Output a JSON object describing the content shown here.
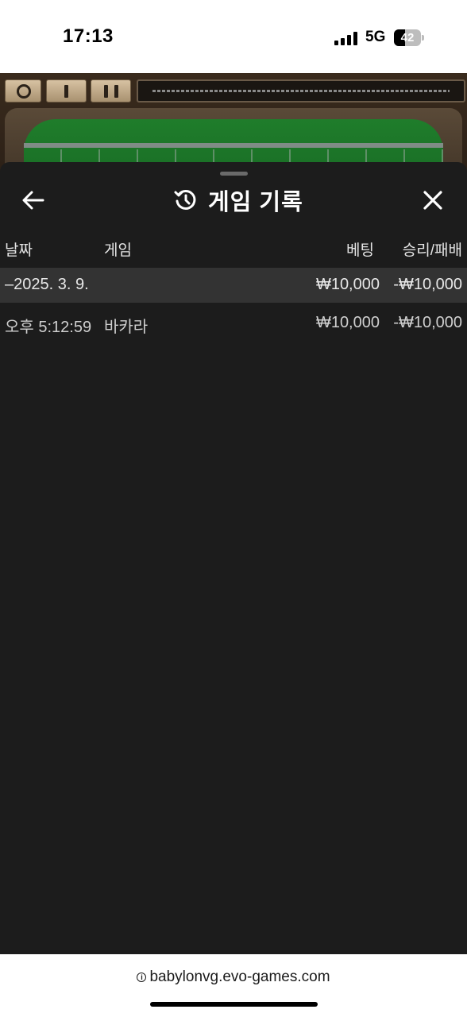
{
  "status": {
    "time": "17:13",
    "network": "5G",
    "battery_level": "42",
    "battery_fraction": 0.42
  },
  "sheet": {
    "title": "게임 기록",
    "icons": {
      "back": "arrow-left-icon",
      "history": "history-icon",
      "close": "close-icon"
    }
  },
  "table": {
    "headers": {
      "date": "날짜",
      "game": "게임",
      "bet": "베팅",
      "result": "승리/패배"
    },
    "date_group": {
      "date": "–2025. 3. 9.",
      "bet": "₩10,000",
      "result": "-₩10,000"
    },
    "rows": [
      {
        "time": "오후 5:12:59",
        "game": "바카라",
        "bet": "₩10,000",
        "result": "-₩10,000"
      }
    ]
  },
  "browser": {
    "url": "babylonvg.evo-games.com",
    "info_icon_glyph": "i"
  },
  "colors": {
    "sheet_bg": "#1c1c1c",
    "date_row_bg": "#333333",
    "felt_green": "#1f7d2b"
  }
}
